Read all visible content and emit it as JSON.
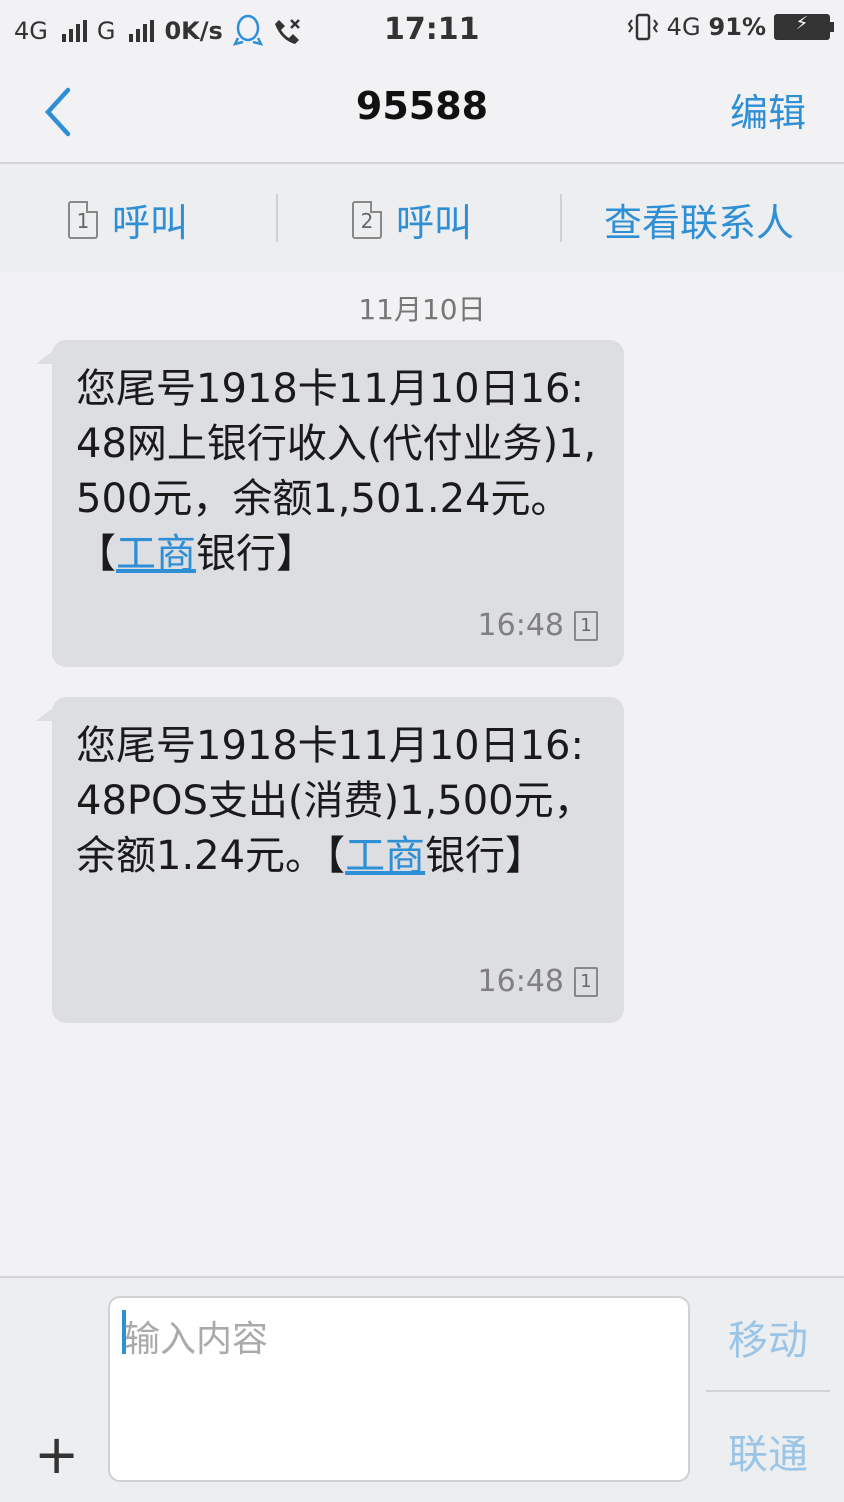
{
  "status_bar": {
    "net1": "4G",
    "net2": "G",
    "speed": "0K/s",
    "time": "17:11",
    "net3": "4G",
    "battery_pct": "91%"
  },
  "nav": {
    "title": "95588",
    "edit_label": "编辑"
  },
  "actions": {
    "call1_sim": "1",
    "call1_label": "呼叫",
    "call2_sim": "2",
    "call2_label": "呼叫",
    "contact_label": "查看联系人"
  },
  "date_label": "11月10日",
  "messages": [
    {
      "text_before": "您尾号1918卡11月10日16:48网上银行收入(代付业务)1,500元，余额1,501.24元。【",
      "link": "工商",
      "text_after": "银行】",
      "time": "16:48",
      "sim": "1"
    },
    {
      "text_before": "您尾号1918卡11月10日16:48POS支出(消费)1,500元，余额1.24元。【",
      "link": "工商",
      "text_after": "银行】",
      "time": "16:48",
      "sim": "1"
    }
  ],
  "composer": {
    "placeholder": "输入内容",
    "send1_label": "移动",
    "send2_label": "联通",
    "plus": "+"
  },
  "colors": {
    "accent": "#2f8fd4",
    "bubble": "#dcdee2",
    "background": "#f2f2f4"
  }
}
